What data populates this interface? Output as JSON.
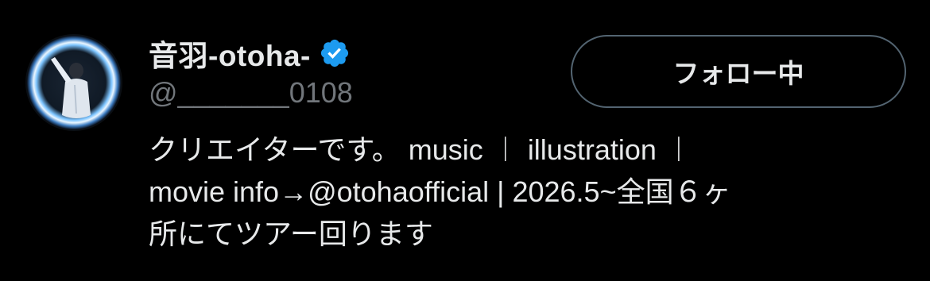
{
  "profile": {
    "display_name": "音羽-otoha-",
    "handle": "@_______0108",
    "verified_icon": "verified-badge-icon",
    "avatar_icon": "profile-photo"
  },
  "follow_button": {
    "label": "フォロー中"
  },
  "bio": {
    "line1": "クリエイターです。 music ︱ illustration ︱",
    "line2_prefix": "movie info→",
    "line2_mention": "@otohaofficial",
    "line2_suffix": " | 2026.5~全国６ヶ",
    "line3": "所にてツアー回ります"
  },
  "colors": {
    "background": "#000000",
    "text_primary": "#e7e9ea",
    "text_secondary": "#71767b",
    "verified_blue": "#1d9bf0",
    "button_border": "#536471"
  }
}
